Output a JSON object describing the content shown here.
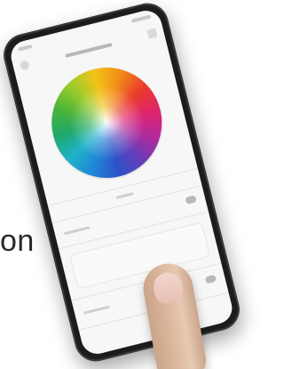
{
  "scene": {
    "side_text": "on"
  },
  "phone": {
    "app": {
      "header_title": "",
      "color_wheel": {
        "colors": [
          "#f2c318",
          "#f28a18",
          "#ea3b2b",
          "#e0246c",
          "#b42a9a",
          "#6b3bb8",
          "#2d52c8",
          "#1f86d8",
          "#1fb2c8",
          "#1fa86a",
          "#4cb43a",
          "#9ccb2a"
        ]
      },
      "icons": {
        "back": "back-icon",
        "menu": "menu-icon"
      }
    }
  }
}
